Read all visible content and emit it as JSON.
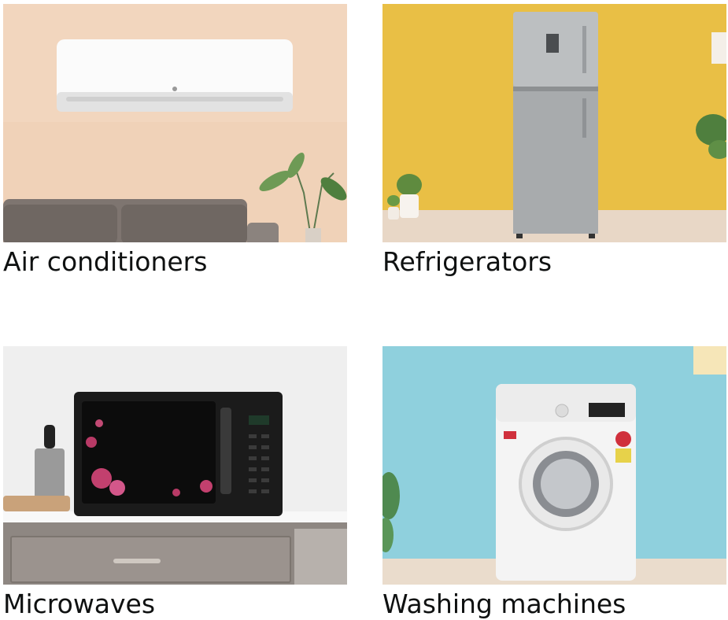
{
  "categories": [
    {
      "label": "Air conditioners",
      "image": "air-conditioner-product-image"
    },
    {
      "label": "Refrigerators",
      "image": "refrigerator-product-image"
    },
    {
      "label": "Microwaves",
      "image": "microwave-product-image"
    },
    {
      "label": "Washing machines",
      "image": "washing-machine-product-image"
    }
  ],
  "colors": {
    "text": "#0f1111",
    "ac_wall": "#f0d2b8",
    "fridge_wall": "#e9bf45",
    "microwave_wall": "#efefef",
    "washer_wall": "#8fd0dd"
  }
}
